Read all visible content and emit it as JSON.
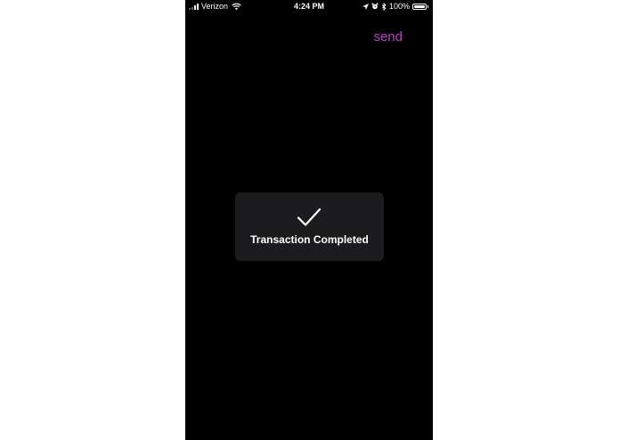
{
  "status_bar": {
    "carrier": "Verizon",
    "time": "4:24 PM",
    "battery_percent": "100%",
    "signal_bars_active": 2,
    "signal_bars_total": 4
  },
  "nav": {
    "send_label": "send"
  },
  "hud": {
    "message": "Transaction Completed",
    "icon": "checkmark-icon"
  },
  "colors": {
    "background": "#000000",
    "accent": "#c040c8",
    "hud_background": "#1c1c1e"
  }
}
